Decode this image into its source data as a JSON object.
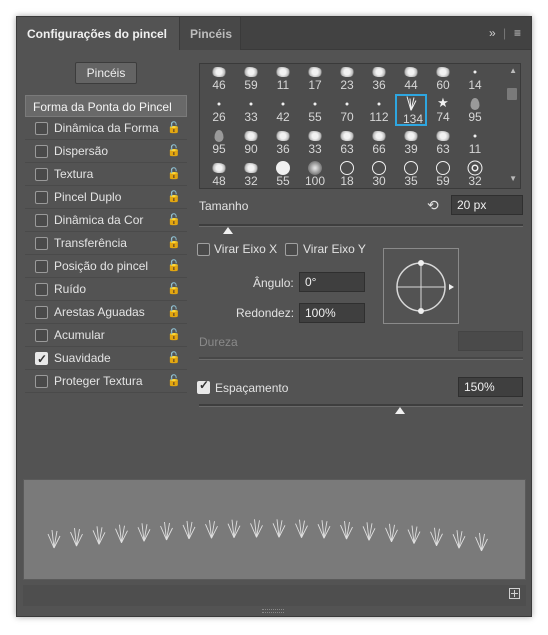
{
  "tabs": [
    {
      "label": "Configurações do pincel"
    },
    {
      "label": "Pincéis"
    }
  ],
  "tab_controls": {
    "expand": "»",
    "menu": "≡"
  },
  "brushes_button": "Pincéis",
  "left_list": {
    "header": "Forma da Ponta do Pincel",
    "items": [
      {
        "label": "Dinâmica da Forma",
        "checked": false,
        "lock": "🔓"
      },
      {
        "label": "Dispersão",
        "checked": false,
        "lock": "🔓"
      },
      {
        "label": "Textura",
        "checked": false,
        "lock": "🔓"
      },
      {
        "label": "Pincel Duplo",
        "checked": false,
        "lock": "🔓"
      },
      {
        "label": "Dinâmica da Cor",
        "checked": false,
        "lock": "🔓"
      },
      {
        "label": "Transferência",
        "checked": false,
        "lock": "🔓"
      },
      {
        "label": "Posição do pincel",
        "checked": false,
        "lock": "🔓"
      },
      {
        "label": "Ruído",
        "checked": false,
        "lock": "🔓"
      },
      {
        "label": "Arestas Aguadas",
        "checked": false,
        "lock": "🔓"
      },
      {
        "label": "Acumular",
        "checked": false,
        "lock": "🔓"
      },
      {
        "label": "Suavidade",
        "checked": true,
        "lock": "🔓"
      },
      {
        "label": "Proteger Textura",
        "checked": false,
        "lock": "🔓"
      }
    ]
  },
  "brush_tips": [
    {
      "size": "46",
      "shape": "blob"
    },
    {
      "size": "59",
      "shape": "blob"
    },
    {
      "size": "11",
      "shape": "blob"
    },
    {
      "size": "17",
      "shape": "blob"
    },
    {
      "size": "23",
      "shape": "blob"
    },
    {
      "size": "36",
      "shape": "blob"
    },
    {
      "size": "44",
      "shape": "blob"
    },
    {
      "size": "60",
      "shape": "blob"
    },
    {
      "size": "14",
      "shape": "dot"
    },
    {
      "size": "26",
      "shape": "dot"
    },
    {
      "size": "33",
      "shape": "dot"
    },
    {
      "size": "42",
      "shape": "dot"
    },
    {
      "size": "55",
      "shape": "dot"
    },
    {
      "size": "70",
      "shape": "dot"
    },
    {
      "size": "112",
      "shape": "dot"
    },
    {
      "size": "134",
      "shape": "grass"
    },
    {
      "size": "74",
      "shape": "star"
    },
    {
      "size": "95",
      "shape": "drop"
    },
    {
      "size": "95",
      "shape": "drop"
    },
    {
      "size": "90",
      "shape": "blob"
    },
    {
      "size": "36",
      "shape": "blob"
    },
    {
      "size": "33",
      "shape": "blob"
    },
    {
      "size": "63",
      "shape": "blob"
    },
    {
      "size": "66",
      "shape": "blob"
    },
    {
      "size": "39",
      "shape": "blob"
    },
    {
      "size": "63",
      "shape": "blob"
    },
    {
      "size": "11",
      "shape": "dot"
    },
    {
      "size": "48",
      "shape": "blob"
    },
    {
      "size": "32",
      "shape": "blob"
    },
    {
      "size": "55",
      "shape": "solid"
    },
    {
      "size": "100",
      "shape": "soft"
    },
    {
      "size": "18",
      "shape": "ring"
    },
    {
      "size": "30",
      "shape": "ring"
    },
    {
      "size": "35",
      "shape": "ring"
    },
    {
      "size": "59",
      "shape": "ring"
    },
    {
      "size": "32",
      "shape": "double-ring"
    }
  ],
  "selected_tip": "134",
  "size": {
    "label": "Tamanho",
    "value": "20 px",
    "slider_fraction": 0.1
  },
  "flip_x": {
    "label": "Virar Eixo X",
    "checked": false
  },
  "flip_y": {
    "label": "Virar Eixo Y",
    "checked": false
  },
  "angle": {
    "label": "Ângulo:",
    "value": "0°"
  },
  "roundness": {
    "label": "Redondez:",
    "value": "100%"
  },
  "hardness": {
    "label": "Dureza",
    "value": ""
  },
  "spacing": {
    "label": "Espaçamento",
    "value": "150%",
    "checked": true,
    "slider_fraction": 0.6
  },
  "colors": {
    "panel": "#535353",
    "selection": "#2ea6e0",
    "preview": "#7a7a7a"
  }
}
